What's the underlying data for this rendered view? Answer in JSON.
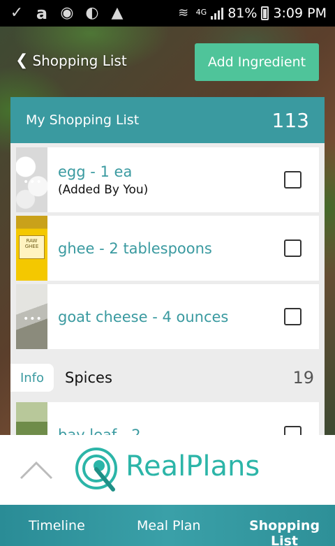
{
  "status_bar": {
    "left_icons": [
      "check-icon",
      "amazon-icon",
      "app-icon",
      "app-icon",
      "drive-icon"
    ],
    "network": "4G",
    "battery": "81%",
    "time": "3:09 PM"
  },
  "header": {
    "back_label": "Shopping List",
    "add_button_label": "Add Ingredient"
  },
  "panel": {
    "title": "My Shopping List",
    "count": "113",
    "items": [
      {
        "name": "egg - 1 ea",
        "sub": "(Added By You)",
        "thumb": "egg-image"
      },
      {
        "name": "ghee - 2 tablespoons",
        "sub": "",
        "thumb": "ghee-jar-image",
        "thumb_label": "RAW GHEE"
      },
      {
        "name": "goat cheese - 4 ounces",
        "sub": "",
        "thumb": "goat-cheese-image"
      },
      {
        "name": "bay leaf - 2",
        "sub": "",
        "thumb": "bay-leaf-jar-image"
      }
    ],
    "section": {
      "info_label": "Info",
      "title": "Spices",
      "count": "19"
    }
  },
  "logo": {
    "text": "RealPlans"
  },
  "nav": {
    "timeline": "Timeline",
    "meal_plan": "Meal Plan",
    "shopping_list": "Shopping List",
    "active": "shopping_list"
  },
  "colors": {
    "teal": "#3a9aa0",
    "green_button": "#4fc49a",
    "logo_teal": "#2cb5a8"
  }
}
